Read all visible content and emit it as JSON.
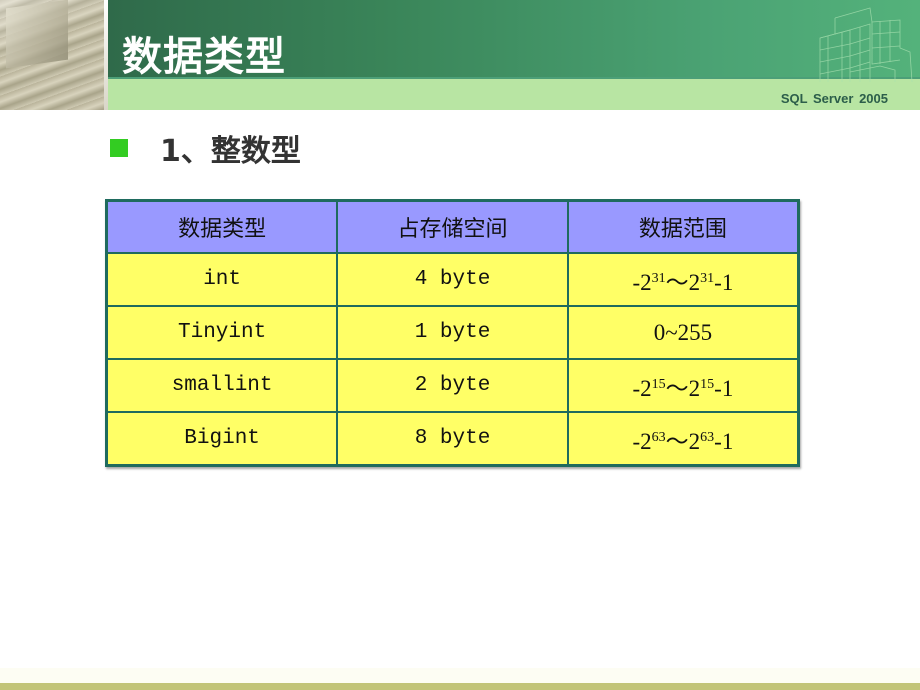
{
  "header": {
    "title": "数据类型",
    "brand": "SQL  Server 2005"
  },
  "bullet": {
    "text": "1、整数型",
    "color": "#33cc22"
  },
  "table": {
    "columns": [
      "数据类型",
      "占存储空间",
      "数据范围"
    ],
    "rows": [
      {
        "type": "int",
        "size": "4 byte",
        "range": {
          "pre": "-2",
          "exp1": "31",
          "mid": "～2",
          "exp2": "31",
          "post": "-1"
        }
      },
      {
        "type": "Tinyint",
        "size": "1 byte",
        "range_text": "0~255"
      },
      {
        "type": "smallint",
        "size": "2 byte",
        "range": {
          "pre": "-2",
          "exp1": "15",
          "mid": "～2",
          "exp2": "15",
          "post": "-1"
        }
      },
      {
        "type": "Bigint",
        "size": "8 byte",
        "range": {
          "pre": "-2",
          "exp1": "63",
          "mid": "～2",
          "exp2": "63",
          "post": "-1"
        }
      }
    ],
    "colors": {
      "header_bg": "#9999ff",
      "cell_bg": "#ffff66",
      "border": "#1f6b5e"
    }
  }
}
